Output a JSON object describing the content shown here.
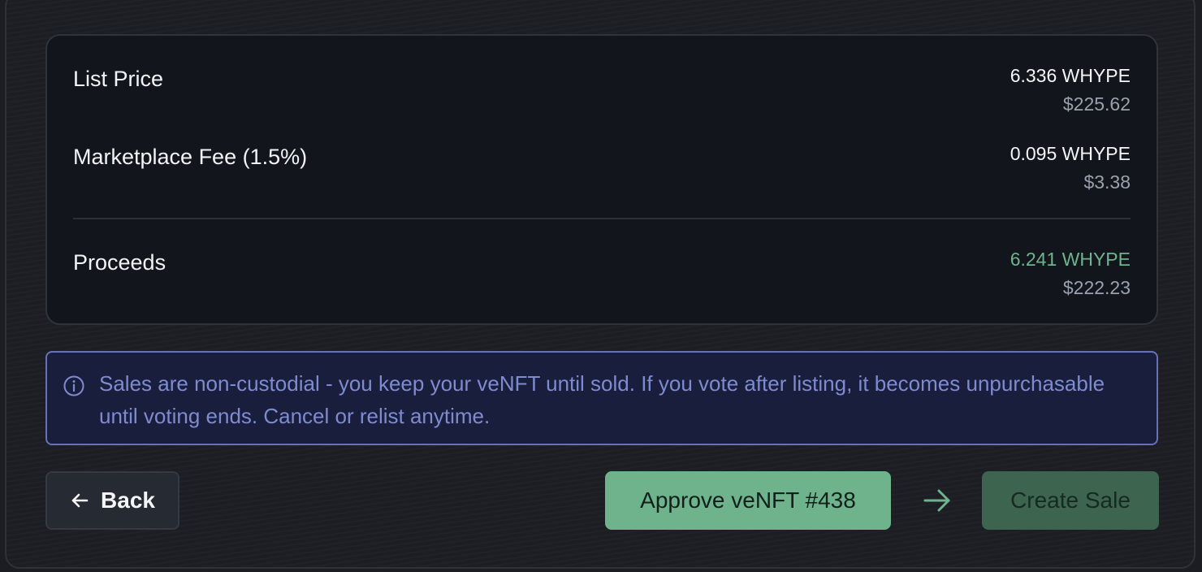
{
  "summary": {
    "rows": [
      {
        "label": "List Price",
        "amount": "6.336 WHYPE",
        "usd": "$225.62"
      },
      {
        "label": "Marketplace Fee (1.5%)",
        "amount": "0.095 WHYPE",
        "usd": "$3.38"
      }
    ],
    "proceeds": {
      "label": "Proceeds",
      "amount": "6.241 WHYPE",
      "usd": "$222.23"
    }
  },
  "info": {
    "icon": "info-icon",
    "text": "Sales are non-custodial - you keep your veNFT until sold. If you vote after listing, it becomes unpurchasable until voting ends. Cancel or relist anytime."
  },
  "actions": {
    "back_label": "Back",
    "back_icon": "arrow-left-icon",
    "approve_label": "Approve veNFT #438",
    "step_icon": "arrow-right-icon",
    "create_label": "Create Sale"
  },
  "colors": {
    "accent_green": "#6fb38c",
    "info_border": "#6672b8",
    "info_text": "#7f8bd0"
  }
}
